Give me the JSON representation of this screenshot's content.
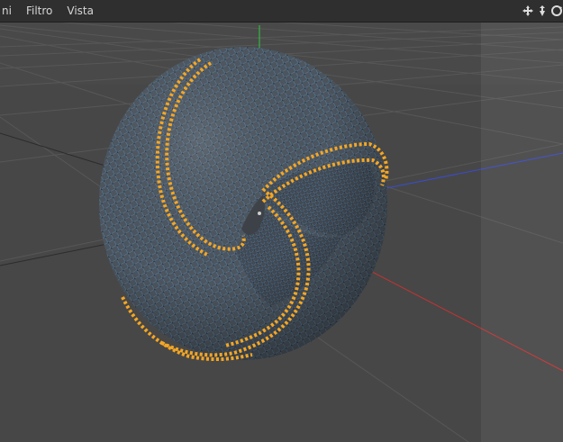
{
  "menu": {
    "items": [
      "ni",
      "Filtro",
      "Vista"
    ]
  },
  "nav_icons": [
    "move-view-icon",
    "dolly-view-icon",
    "rotate-view-icon"
  ],
  "colors": {
    "menubar_bg": "#2f2f2f",
    "viewport_bg": "#474747",
    "grid_line": "#555555",
    "axis_x": "#c83232",
    "axis_y": "#2ecc40",
    "axis_z": "#3a4cd0",
    "mesh_fill": "#4d5660",
    "wireframe": "#5fb0ee",
    "selected_points": "#f5a623"
  }
}
